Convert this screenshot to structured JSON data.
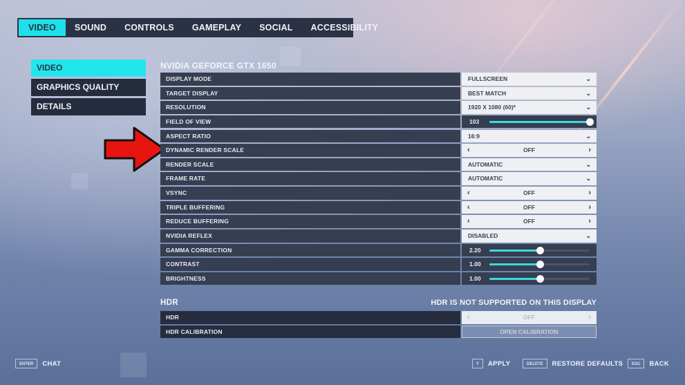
{
  "top_tabs": [
    {
      "label": "VIDEO",
      "active": true
    },
    {
      "label": "SOUND",
      "active": false
    },
    {
      "label": "CONTROLS",
      "active": false
    },
    {
      "label": "GAMEPLAY",
      "active": false
    },
    {
      "label": "SOCIAL",
      "active": false
    },
    {
      "label": "ACCESSIBILITY",
      "active": false
    }
  ],
  "side_nav": [
    {
      "label": "VIDEO",
      "active": true
    },
    {
      "label": "GRAPHICS QUALITY",
      "active": false
    },
    {
      "label": "DETAILS",
      "active": false
    }
  ],
  "gpu_section": {
    "title": "NVIDIA GEFORCE GTX 1650",
    "settings": [
      {
        "label": "DISPLAY MODE",
        "type": "dropdown",
        "value": "FULLSCREEN"
      },
      {
        "label": "TARGET DISPLAY",
        "type": "dropdown",
        "value": "BEST MATCH"
      },
      {
        "label": "RESOLUTION",
        "type": "dropdown",
        "value": "1920 X 1080 (60)*"
      },
      {
        "label": "FIELD OF VIEW",
        "type": "slider",
        "value": "103",
        "fill_fraction": 1.0
      },
      {
        "label": "ASPECT RATIO",
        "type": "dropdown",
        "value": "16:9"
      },
      {
        "label": "DYNAMIC RENDER SCALE",
        "type": "toggle",
        "value": "OFF"
      },
      {
        "label": "RENDER SCALE",
        "type": "dropdown",
        "value": "AUTOMATIC"
      },
      {
        "label": "FRAME RATE",
        "type": "dropdown",
        "value": "AUTOMATIC"
      },
      {
        "label": "VSYNC",
        "type": "toggle",
        "value": "OFF"
      },
      {
        "label": "TRIPLE BUFFERING",
        "type": "toggle",
        "value": "OFF"
      },
      {
        "label": "REDUCE BUFFERING",
        "type": "toggle",
        "value": "OFF"
      },
      {
        "label": "NVIDIA REFLEX",
        "type": "dropdown",
        "value": "DISABLED"
      },
      {
        "label": "GAMMA CORRECTION",
        "type": "slider",
        "value": "2.20",
        "fill_fraction": 0.5
      },
      {
        "label": "CONTRAST",
        "type": "slider",
        "value": "1.00",
        "fill_fraction": 0.5
      },
      {
        "label": "BRIGHTNESS",
        "type": "slider",
        "value": "1.00",
        "fill_fraction": 0.5
      }
    ]
  },
  "hdr_section": {
    "title": "HDR",
    "note": "HDR IS NOT SUPPORTED ON THIS DISPLAY",
    "settings": [
      {
        "label": "HDR",
        "type": "toggle",
        "value": "OFF",
        "disabled": true
      },
      {
        "label": "HDR CALIBRATION",
        "type": "button",
        "value": "OPEN CALIBRATION",
        "disabled": true
      }
    ]
  },
  "annotation": {
    "arrow_color": "#e8140f",
    "points_to": "DYNAMIC RENDER SCALE"
  },
  "icons": {
    "chevron_down": "⌄",
    "arrow_left": "‹",
    "arrow_right": "›"
  },
  "colors": {
    "accent": "#1fe0ea",
    "panel": "#363e52",
    "slider_fill": "#3fd9dd"
  },
  "footer": {
    "chat": {
      "key": "ENTER",
      "label": "CHAT"
    },
    "apply": {
      "key": "Y",
      "label": "APPLY"
    },
    "restore": {
      "key": "DELETE",
      "label": "RESTORE DEFAULTS"
    },
    "back": {
      "key": "ESC",
      "label": "BACK"
    }
  }
}
